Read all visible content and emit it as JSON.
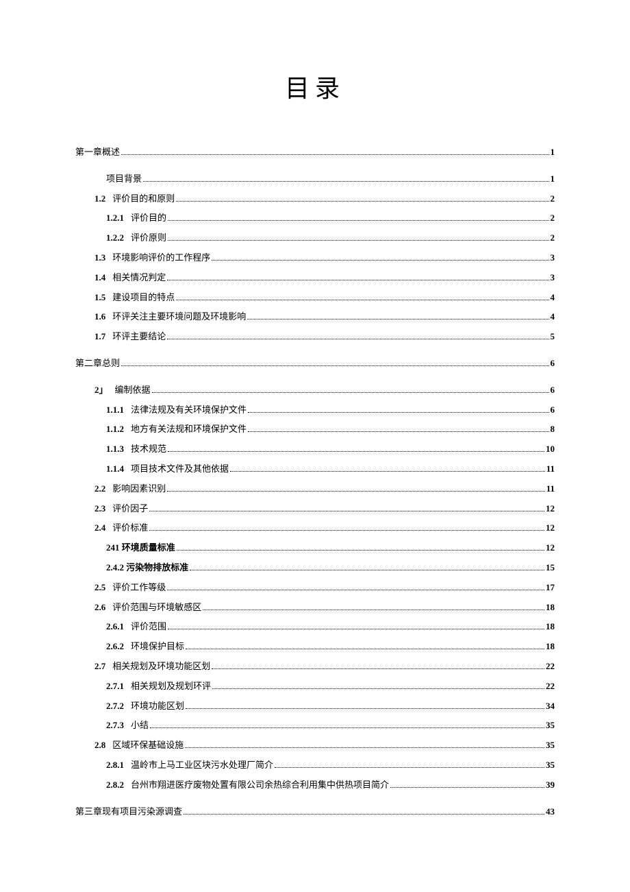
{
  "title": "目录",
  "entries": [
    {
      "level": "level-0",
      "number": "",
      "text": "第一章概述",
      "page": "1"
    },
    {
      "level": "level-1b",
      "number": "",
      "text": "项目背景",
      "page": "1"
    },
    {
      "level": "level-1",
      "number": "1.2",
      "text": "评价目的和原则",
      "page": "2"
    },
    {
      "level": "level-2",
      "number": "1.2.1",
      "text": "评价目的",
      "page": "2"
    },
    {
      "level": "level-2",
      "number": "1.2.2",
      "text": "评价原则",
      "page": "2"
    },
    {
      "level": "level-1",
      "number": "1.3",
      "text": "环境影响评价的工作程序",
      "page": "3"
    },
    {
      "level": "level-1",
      "number": "1.4",
      "text": "相关情况判定",
      "page": "3"
    },
    {
      "level": "level-1",
      "number": "1.5",
      "text": "建设项目的特点",
      "page": "4"
    },
    {
      "level": "level-1",
      "number": "1.6",
      "text": "环评关注主要环境问题及环境影响",
      "page": "4"
    },
    {
      "level": "level-1",
      "number": "1.7",
      "text": "环评主要结论",
      "page": "5"
    },
    {
      "level": "level-0",
      "number": "",
      "text": "第二章总则",
      "page": "6"
    },
    {
      "level": "level-1",
      "number": "2」",
      "text": "编制依据",
      "page": "6"
    },
    {
      "level": "level-2",
      "number": "1.1.1",
      "text": "法律法规及有关环境保护文件",
      "page": "6"
    },
    {
      "level": "level-2",
      "number": "1.1.2",
      "text": "地方有关法规和环境保护文件",
      "page": "8"
    },
    {
      "level": "level-2",
      "number": "1.1.3",
      "text": "技术规范",
      "page": "10"
    },
    {
      "level": "level-2",
      "number": "1.1.4",
      "text": "项目技术文件及其他依据",
      "page": "11"
    },
    {
      "level": "level-1",
      "number": "2.2",
      "text": "影响因素识别",
      "page": "11"
    },
    {
      "level": "level-1",
      "number": "2.3",
      "text": "评价因子",
      "page": "12"
    },
    {
      "level": "level-1",
      "number": "2.4",
      "text": "评价标准",
      "page": "12"
    },
    {
      "level": "level-2b",
      "number": "",
      "text": "241 环境质量标准",
      "page": "12"
    },
    {
      "level": "level-2b",
      "number": "",
      "text": "2.4.2 污染物排放标准",
      "page": "15"
    },
    {
      "level": "level-1",
      "number": "2.5",
      "text": "评价工作等级",
      "page": "17"
    },
    {
      "level": "level-1",
      "number": "2.6",
      "text": "评价范围与环境敏感区",
      "page": "18"
    },
    {
      "level": "level-2",
      "number": "2.6.1",
      "text": "评价范围",
      "page": "18"
    },
    {
      "level": "level-2",
      "number": "2.6.2",
      "text": "环境保护目标",
      "page": "18"
    },
    {
      "level": "level-1",
      "number": "2.7",
      "text": "相关规划及环境功能区划",
      "page": "22"
    },
    {
      "level": "level-2",
      "number": "2.7.1",
      "text": "相关规划及规划环评",
      "page": "22"
    },
    {
      "level": "level-2",
      "number": "2.7.2",
      "text": "环境功能区划",
      "page": "34"
    },
    {
      "level": "level-2",
      "number": "2.7.3",
      "text": "小结",
      "page": "35"
    },
    {
      "level": "level-1",
      "number": "2.8",
      "text": "区域环保基础设施",
      "page": "35"
    },
    {
      "level": "level-2",
      "number": "2.8.1",
      "text": "温岭市上马工业区块污水处理厂简介",
      "page": "35"
    },
    {
      "level": "level-2",
      "number": "2.8.2",
      "text": "台州市翔进医疗废物处置有限公司余热综合利用集中供热项目简介",
      "page": "39"
    },
    {
      "level": "level-0",
      "number": "",
      "text": "第三章现有项目污染源调查",
      "page": "43"
    }
  ]
}
